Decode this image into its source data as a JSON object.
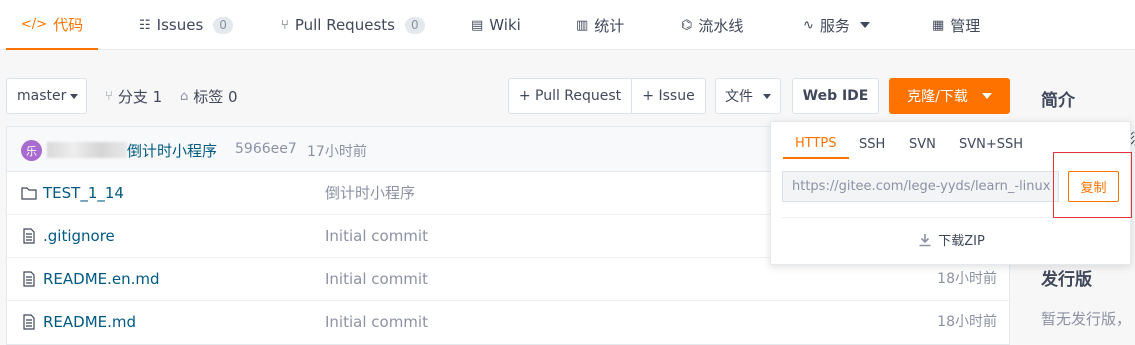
{
  "nav_tabs": [
    {
      "label": "代码",
      "icon": "code-icon",
      "active": true
    },
    {
      "label": "Issues",
      "icon": "issues-icon",
      "count": "0"
    },
    {
      "label": "Pull Requests",
      "icon": "pull-request-icon",
      "count": "0"
    },
    {
      "label": "Wiki",
      "icon": "book-icon"
    },
    {
      "label": "统计",
      "icon": "bar-chart-icon"
    },
    {
      "label": "流水线",
      "icon": "pipeline-icon"
    },
    {
      "label": "服务",
      "icon": "pulse-icon"
    },
    {
      "label": "管理",
      "icon": "manage-icon"
    }
  ],
  "toolbar": {
    "branch": "master",
    "branches": "分支 1",
    "tags": "标签 0",
    "pull_request": "+ Pull Request",
    "issue": "+ Issue",
    "file": "文件",
    "web_ide": "Web IDE",
    "clone": "克隆/下载"
  },
  "commit": {
    "avatar_letter": "乐",
    "message": "倒计时小程序",
    "hash": "5966ee7",
    "time": "17小时前"
  },
  "files": [
    {
      "name": "TEST_1_14",
      "type": "folder",
      "message": "倒计时小程序",
      "time": ""
    },
    {
      "name": ".gitignore",
      "type": "file",
      "message": "Initial commit",
      "time": ""
    },
    {
      "name": "README.en.md",
      "type": "file",
      "message": "Initial commit",
      "time": "18小时前"
    },
    {
      "name": "README.md",
      "type": "file",
      "message": "Initial commit",
      "time": "18小时前"
    }
  ],
  "sidebar": {
    "intro_title": "简介",
    "release_title": "发行版",
    "release_text": "暂无发行版，",
    "intro_cut": "须"
  },
  "clone_dropdown": {
    "tabs": [
      "HTTPS",
      "SSH",
      "SVN",
      "SVN+SSH"
    ],
    "active_tab": "HTTPS",
    "url": "https://gitee.com/lege-yyds/learn_-linux",
    "copy_label": "复制",
    "download_label": "下载ZIP"
  },
  "colors": {
    "accent": "#fe7300",
    "link": "#005980",
    "highlight": "#e0343a"
  }
}
